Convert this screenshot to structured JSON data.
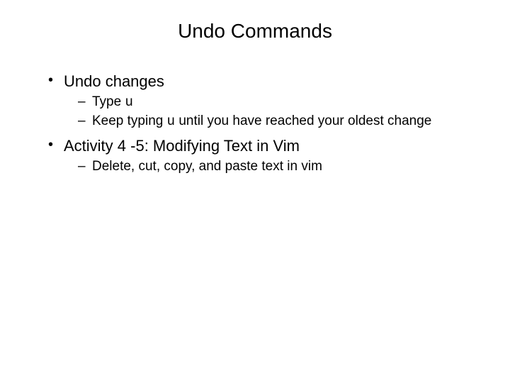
{
  "title": "Undo Commands",
  "b1": "Undo changes",
  "s1a_pre": "Type ",
  "s1a_code": "u",
  "s1b_pre": "Keep typing ",
  "s1b_code": "u",
  "s1b_post": " until you have reached your oldest change",
  "b2": "Activity 4 -5: Modifying Text in Vim",
  "s2a": "Delete, cut, copy, and paste text in vim"
}
